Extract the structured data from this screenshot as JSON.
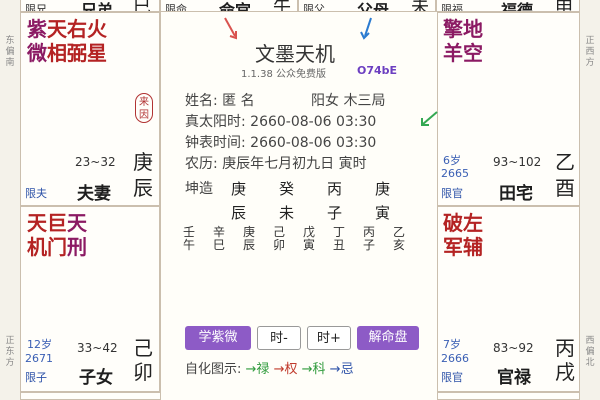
{
  "directions": {
    "left_top": "东偏南",
    "left_bottom": "正东方",
    "right_top": "正西方",
    "right_bottom": "西偏北"
  },
  "top_row": [
    {
      "small": "限兄",
      "palace": "兄弟",
      "branch": "巳"
    },
    {
      "small": "限命",
      "palace": "命宫",
      "branch": "午"
    },
    {
      "small": "限父",
      "palace": "父母",
      "branch": "未"
    },
    {
      "small": "限福",
      "palace": "福德",
      "branch": "申"
    }
  ],
  "cells": {
    "wife": {
      "stars_row1": [
        "紫",
        "天",
        "右",
        "火"
      ],
      "stars_row2": [
        "微",
        "相",
        "弼",
        "星"
      ],
      "badge_top": "来",
      "badge_bottom": "因",
      "range": "23~32",
      "stem": "庚",
      "tag": "限夫",
      "palace": "夫妻",
      "branch": "辰"
    },
    "property": {
      "stars_row1": [
        "擎",
        "地"
      ],
      "stars_row2": [
        "羊",
        "空"
      ],
      "age": "6岁",
      "year": "2665",
      "tag": "限官",
      "range": "93~102",
      "stem": "乙",
      "palace": "田宅",
      "branch": "酉"
    },
    "children": {
      "stars_row1": [
        "天",
        "巨",
        "天"
      ],
      "stars_row2": [
        "机",
        "门",
        "刑"
      ],
      "age": "12岁",
      "year": "2671",
      "tag": "限子",
      "range": "33~42",
      "stem": "己",
      "palace": "子女",
      "branch": "卯"
    },
    "career": {
      "stars_row1": [
        "破",
        "左"
      ],
      "stars_row2": [
        "军",
        "辅"
      ],
      "age": "7岁",
      "year": "2666",
      "tag": "限官",
      "range": "83~92",
      "stem": "丙",
      "palace": "官禄",
      "branch": "戌"
    }
  },
  "center": {
    "title": "文墨天机",
    "version": "1.1.38 公众免费版",
    "code": "O74bE",
    "name_label": "姓名: 匿 名",
    "gender": "阳女 木三局",
    "true_solar": "真太阳时: 2660-08-06  03:30",
    "clock": "钟表时间: 2660-08-06  03:30",
    "lunar": "农历: 庚辰年七月初九日 寅时",
    "kunzao": "坤造",
    "heaven_stems": [
      "庚",
      "癸",
      "丙",
      "庚"
    ],
    "earth_branches": [
      "辰",
      "未",
      "子",
      "寅"
    ],
    "cycle": [
      {
        "top": "壬",
        "bot": "午",
        "note": "..."
      },
      {
        "top": "辛",
        "bot": "巳",
        "note": "..."
      },
      {
        "top": "庚",
        "bot": "辰",
        "note": "..."
      },
      {
        "top": "己",
        "bot": "卯",
        "note": "..."
      },
      {
        "top": "戊",
        "bot": "寅",
        "note": "..."
      },
      {
        "top": "丁",
        "bot": "丑",
        "note": "..."
      },
      {
        "top": "丙",
        "bot": "子",
        "note": "..."
      },
      {
        "top": "乙",
        "bot": "亥",
        "note": "..."
      }
    ],
    "buttons": {
      "learn": "学紫微",
      "hour_minus": "时-",
      "hour_plus": "时+",
      "decode": "解命盘"
    },
    "legend": {
      "label": "自化图示:",
      "lu": "→禄",
      "quan": "→权",
      "ke": "→科",
      "ji": "→忌"
    }
  },
  "colors": {
    "star_red": "#b42323",
    "star_purple": "#8b1a63",
    "button_purple": "#8d5bc6",
    "lu_green": "#2e9a3b",
    "quan_red": "#c0392b",
    "ke_green": "#2e9a3b",
    "ji_blue": "#2d52a8"
  }
}
